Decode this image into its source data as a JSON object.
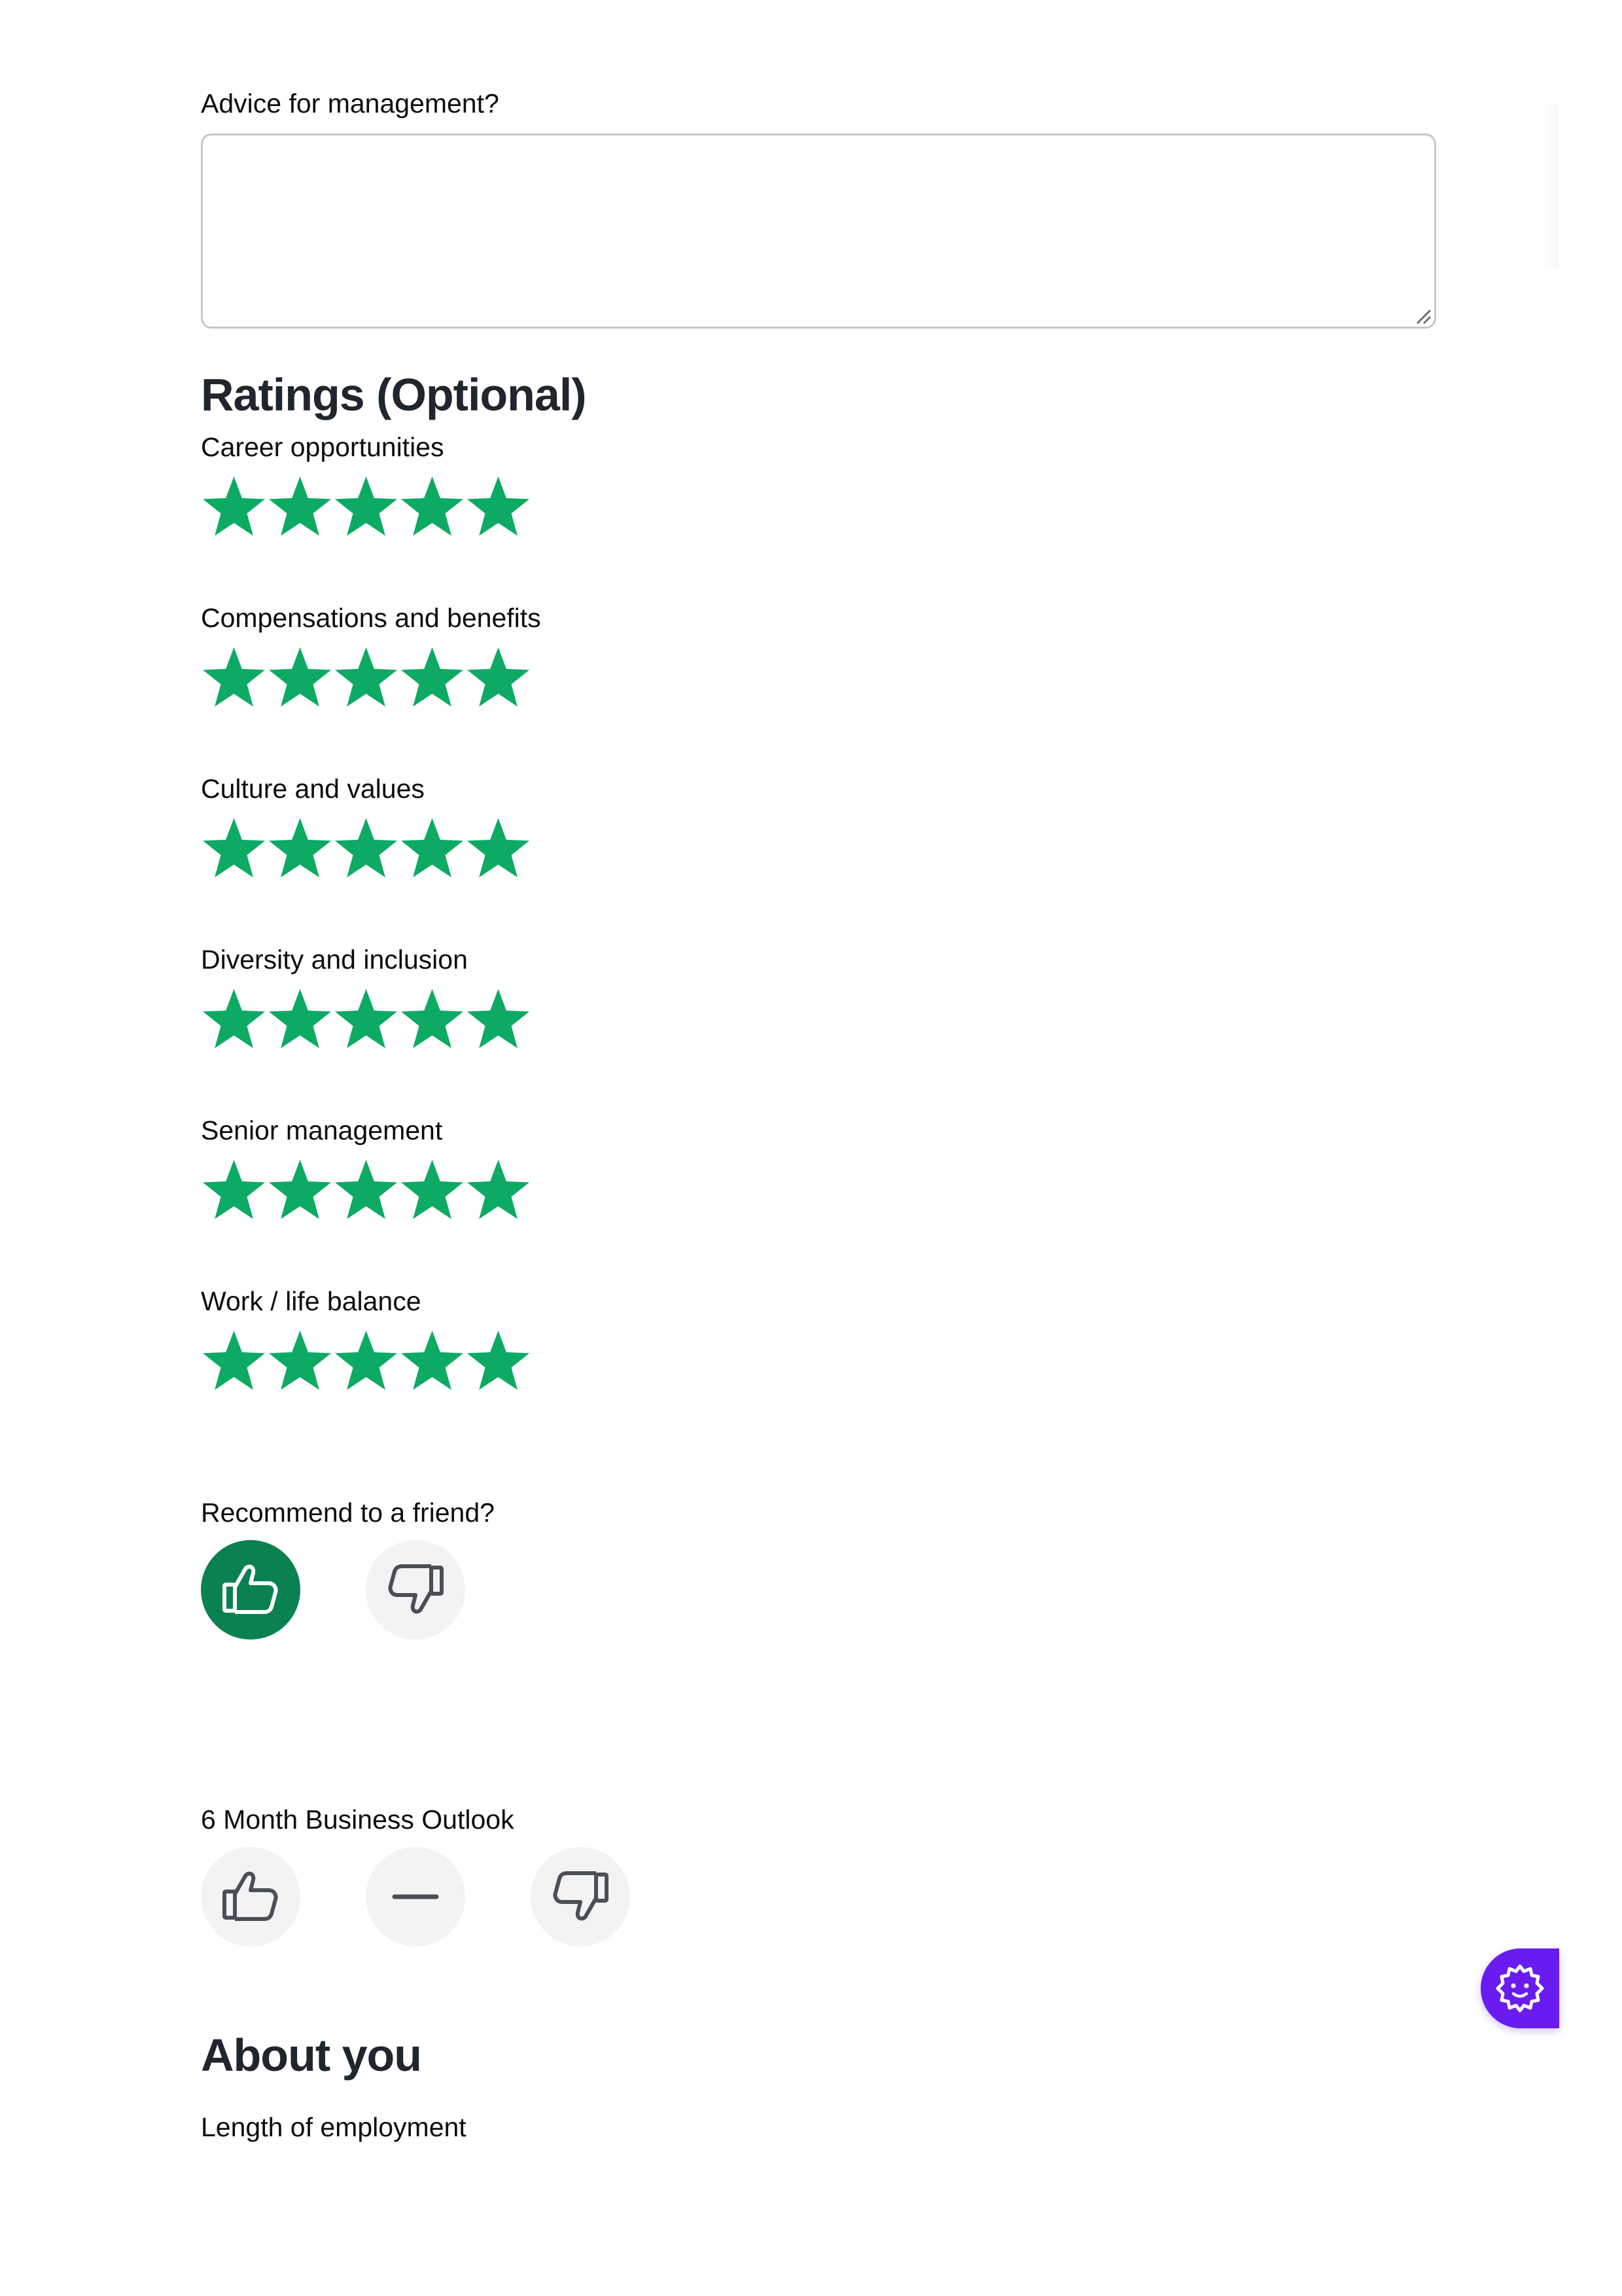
{
  "advice": {
    "label": "Advice for management?",
    "value": "",
    "placeholder": ""
  },
  "ratings": {
    "title": "Ratings (Optional)",
    "max_stars": 5,
    "star_color": "#0caa63",
    "items": [
      {
        "label": "Career opportunities",
        "value": 5
      },
      {
        "label": "Compensations and benefits",
        "value": 5
      },
      {
        "label": "Culture and values",
        "value": 5
      },
      {
        "label": "Diversity and inclusion",
        "value": 5
      },
      {
        "label": "Senior management",
        "value": 5
      },
      {
        "label": "Work / life balance",
        "value": 5
      }
    ]
  },
  "recommend": {
    "label": "Recommend to a friend?",
    "selected": "thumbs-up",
    "selected_color": "#0a8151",
    "options": [
      "thumbs-up-icon",
      "thumbs-down-icon"
    ]
  },
  "outlook": {
    "label": "6 Month Business Outlook",
    "selected": null,
    "options": [
      "thumbs-up-icon",
      "neutral-dash-icon",
      "thumbs-down-icon"
    ]
  },
  "about": {
    "title": "About you",
    "length_label": "Length of employment"
  },
  "widget": {
    "icon": "cookie-settings-icon",
    "color": "#6a1cf0"
  }
}
